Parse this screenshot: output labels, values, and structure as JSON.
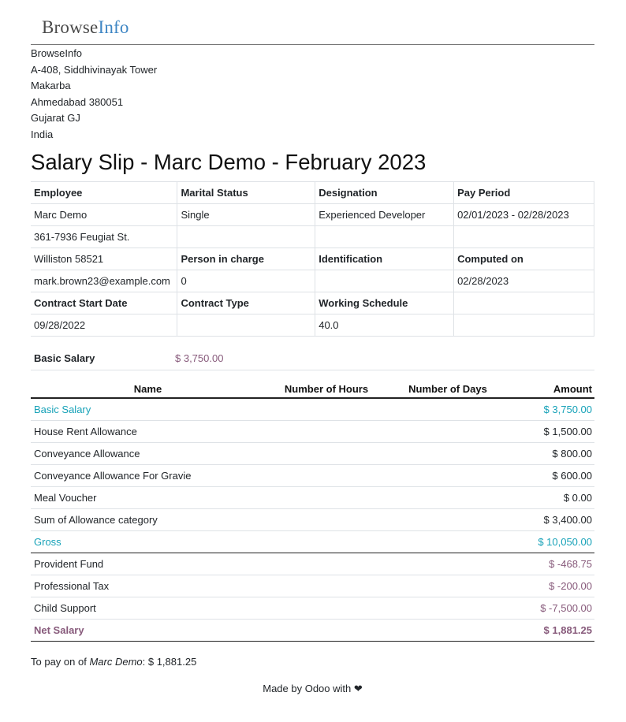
{
  "logo": {
    "part1": "Browse",
    "part2": "Info"
  },
  "company": {
    "lines": [
      "BrowseInfo",
      "A-408, Siddhivinayak Tower",
      "Makarba",
      "Ahmedabad 380051",
      "Gujarat GJ",
      "India"
    ]
  },
  "title": "Salary Slip - Marc Demo - February 2023",
  "info": {
    "employee_label": "Employee",
    "marital_label": "Marital Status",
    "designation_label": "Designation",
    "pay_period_label": "Pay Period",
    "employee_name": "Marc Demo",
    "marital_status": "Single",
    "designation": "Experienced Developer",
    "pay_period": "02/01/2023 - 02/28/2023",
    "street": "361-7936 Feugiat St.",
    "city": "Williston 58521",
    "person_label": "Person in charge",
    "identification_label": "Identification",
    "computed_label": "Computed on",
    "email": "mark.brown23@example.com",
    "person_in_charge": "0",
    "computed_on": "02/28/2023",
    "contract_start_label": "Contract Start Date",
    "contract_type_label": "Contract Type",
    "working_schedule_label": "Working Schedule",
    "contract_start": "09/28/2022",
    "working_schedule": "40.0"
  },
  "basic_salary": {
    "label": "Basic Salary",
    "value": "$ 3,750.00"
  },
  "lines_table": {
    "headers": {
      "name": "Name",
      "hours": "Number of Hours",
      "days": "Number of Days",
      "amount": "Amount"
    },
    "rows": [
      {
        "name": "Basic Salary",
        "amount": "$ 3,750.00",
        "style": "teal"
      },
      {
        "name": "House Rent Allowance",
        "amount": "$ 1,500.00",
        "style": "normal"
      },
      {
        "name": "Conveyance Allowance",
        "amount": "$ 800.00",
        "style": "normal"
      },
      {
        "name": "Conveyance Allowance For Gravie",
        "amount": "$ 600.00",
        "style": "normal"
      },
      {
        "name": "Meal Voucher",
        "amount": "$ 0.00",
        "style": "normal"
      },
      {
        "name": "Sum of Allowance category",
        "amount": "$ 3,400.00",
        "style": "normal"
      },
      {
        "name": "Gross",
        "amount": "$ 10,050.00",
        "style": "teal"
      },
      {
        "name": "Provident Fund",
        "amount": "$ -468.75",
        "style": "deduction"
      },
      {
        "name": "Professional Tax",
        "amount": "$ -200.00",
        "style": "deduction"
      },
      {
        "name": "Child Support",
        "amount": "$ -7,500.00",
        "style": "deduction"
      },
      {
        "name": "Net Salary",
        "amount": "$ 1,881.25",
        "style": "net"
      }
    ]
  },
  "to_pay": {
    "prefix": "To pay on of ",
    "employee": "Marc Demo",
    "suffix": ": $ 1,881.25"
  },
  "footer": {
    "text": "Made by Odoo with ❤"
  },
  "colors": {
    "teal": "#17a2b8",
    "purple": "#875a7b",
    "logo_blue": "#3e86c4"
  }
}
